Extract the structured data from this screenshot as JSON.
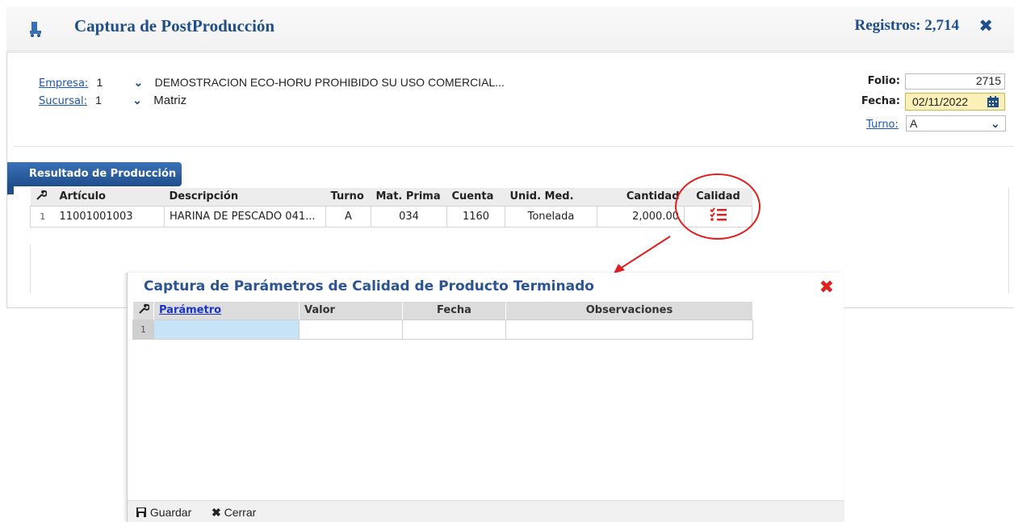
{
  "header": {
    "title": "Captura de PostProducción",
    "records": "Registros: 2,714",
    "app_icon": "truck-icon",
    "close_icon": "close-icon"
  },
  "form": {
    "empresa_label": "Empresa:",
    "empresa_value": "1",
    "empresa_name": "DEMOSTRACION ECO-HORU PROHIBIDO SU USO COMERCIAL...",
    "sucursal_label": "Sucursal:",
    "sucursal_value": "1",
    "sucursal_name": "Matriz",
    "folio_label": "Folio:",
    "folio_value": "2715",
    "fecha_label": "Fecha:",
    "fecha_value": "02/11/2022",
    "turno_label": "Turno:",
    "turno_value": "A"
  },
  "tab": {
    "label": "Resultado de Producción"
  },
  "grid": {
    "headers": [
      "Artículo",
      "Descripción",
      "Turno",
      "Mat. Prima",
      "Cuenta",
      "Unid. Med.",
      "Cantidad",
      "Calidad"
    ],
    "rows": [
      {
        "num": "1",
        "articulo": "11001001003",
        "descripcion": "HARINA DE PESCADO 041...",
        "turno": "A",
        "mat_prima": "034",
        "cuenta": "1160",
        "unid_med": "Tonelada",
        "cantidad": "2,000.00",
        "calidad_icon": "checklist-icon"
      }
    ]
  },
  "modal": {
    "title": "Captura de Parámetros de Calidad de Producto Terminado",
    "headers": [
      "Parámetro",
      "Valor",
      "Fecha",
      "Observaciones"
    ],
    "row_num": "1",
    "save_label": "Guardar",
    "close_label": "Cerrar"
  },
  "colors": {
    "brand_blue": "#1f4e8c",
    "highlight_yellow": "#fbf1b8",
    "annotation_red": "#e02020",
    "cell_selected": "#c7e3f8"
  }
}
